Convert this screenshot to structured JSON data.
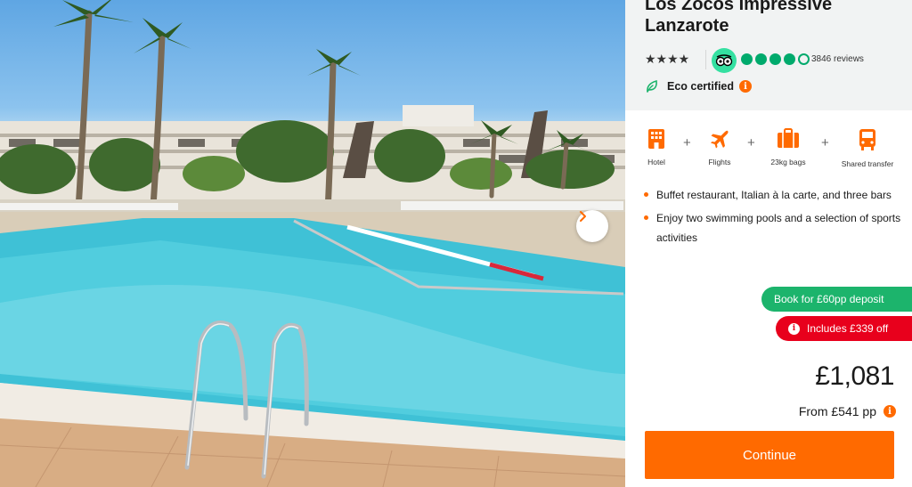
{
  "hotel": {
    "name": "Los Zocos Impressive Lanzarote",
    "stars_glyphs": "★★★★",
    "tripadvisor": {
      "rating_bubbles": 4,
      "max_bubbles": 5,
      "reviews_text": "3846 reviews"
    },
    "eco_label": "Eco certified"
  },
  "includes": [
    {
      "icon": "hotel-icon",
      "label": "Hotel"
    },
    {
      "icon": "flight-icon",
      "label": "Flights"
    },
    {
      "icon": "luggage-icon",
      "label": "23kg bags"
    },
    {
      "icon": "transfer-bus-icon",
      "label": "Shared transfer"
    }
  ],
  "plus_sign": "+",
  "highlights": [
    "Buffet restaurant, Italian à la carte, and three bars",
    "Enjoy two swimming pools and a selection of sports activities"
  ],
  "badges": {
    "deposit": "Book for £60pp deposit",
    "discount": "Includes £339 off"
  },
  "price": {
    "total": "£1,081",
    "per_person": "From £541 pp"
  },
  "cta": {
    "continue_label": "Continue"
  },
  "info_glyph": "i",
  "colors": {
    "accent": "#ff6a00",
    "deposit_green": "#1cb46c",
    "discount_red": "#e8001c",
    "tripadvisor_green": "#00aa6c"
  }
}
